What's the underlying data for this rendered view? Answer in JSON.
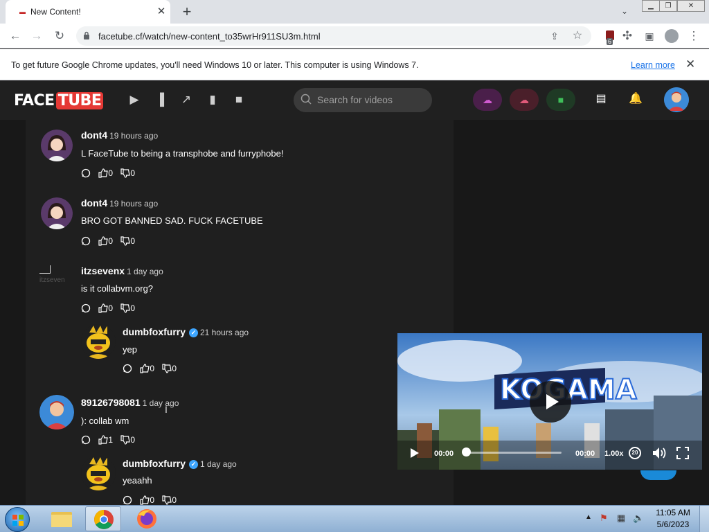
{
  "browser": {
    "tab_title": "New Content!",
    "tab_favicon": "▬",
    "url": "facetube.cf/watch/new-content_to35wrHr911SU3m.html",
    "extension_badge_count": "6",
    "infobar_text": "To get future Google Chrome updates, you'll need Windows 10 or later. This computer is using Windows 7.",
    "infobar_link": "Learn more"
  },
  "site": {
    "logo_face": "FACE",
    "logo_tube": "TUBE",
    "search_placeholder": "Search for videos"
  },
  "comments": [
    {
      "user": "dont4",
      "time": "19 hours ago",
      "text": "L FaceTube to being a transphobe and furryphobe!",
      "likes": "0",
      "dislikes": "0"
    },
    {
      "user": "dont4",
      "time": "19 hours ago",
      "text": "BRO GOT BANNED SAD. FUCK FACETUBE",
      "likes": "0",
      "dislikes": "0"
    },
    {
      "user": "itzsevenx",
      "time": "1 day ago",
      "text": "is it collabvm.org?",
      "likes": "0",
      "dislikes": "0",
      "avatar_alt": "itzseven"
    },
    {
      "user": "dumbfoxfurry",
      "time": "21 hours ago",
      "text": "yep",
      "likes": "0",
      "dislikes": "0"
    },
    {
      "user": "89126798081",
      "time": "1 day ago",
      "text": "): collab wm",
      "likes": "1",
      "dislikes": "0"
    },
    {
      "user": "dumbfoxfurry",
      "time": "1 day ago",
      "text": "yeaahh",
      "likes": "0",
      "dislikes": "0"
    }
  ],
  "player": {
    "current_time": "00:00",
    "duration": "00:00",
    "speed": "1.00x",
    "rewind_label": "20",
    "progress_fraction": 0,
    "game_title": "KOGAMA"
  },
  "taskbar": {
    "time": "11:05 AM",
    "date": "5/6/2023"
  },
  "colors": {
    "accent": "#e53935",
    "verified": "#3ea6ff",
    "link": "#1a73e8"
  }
}
